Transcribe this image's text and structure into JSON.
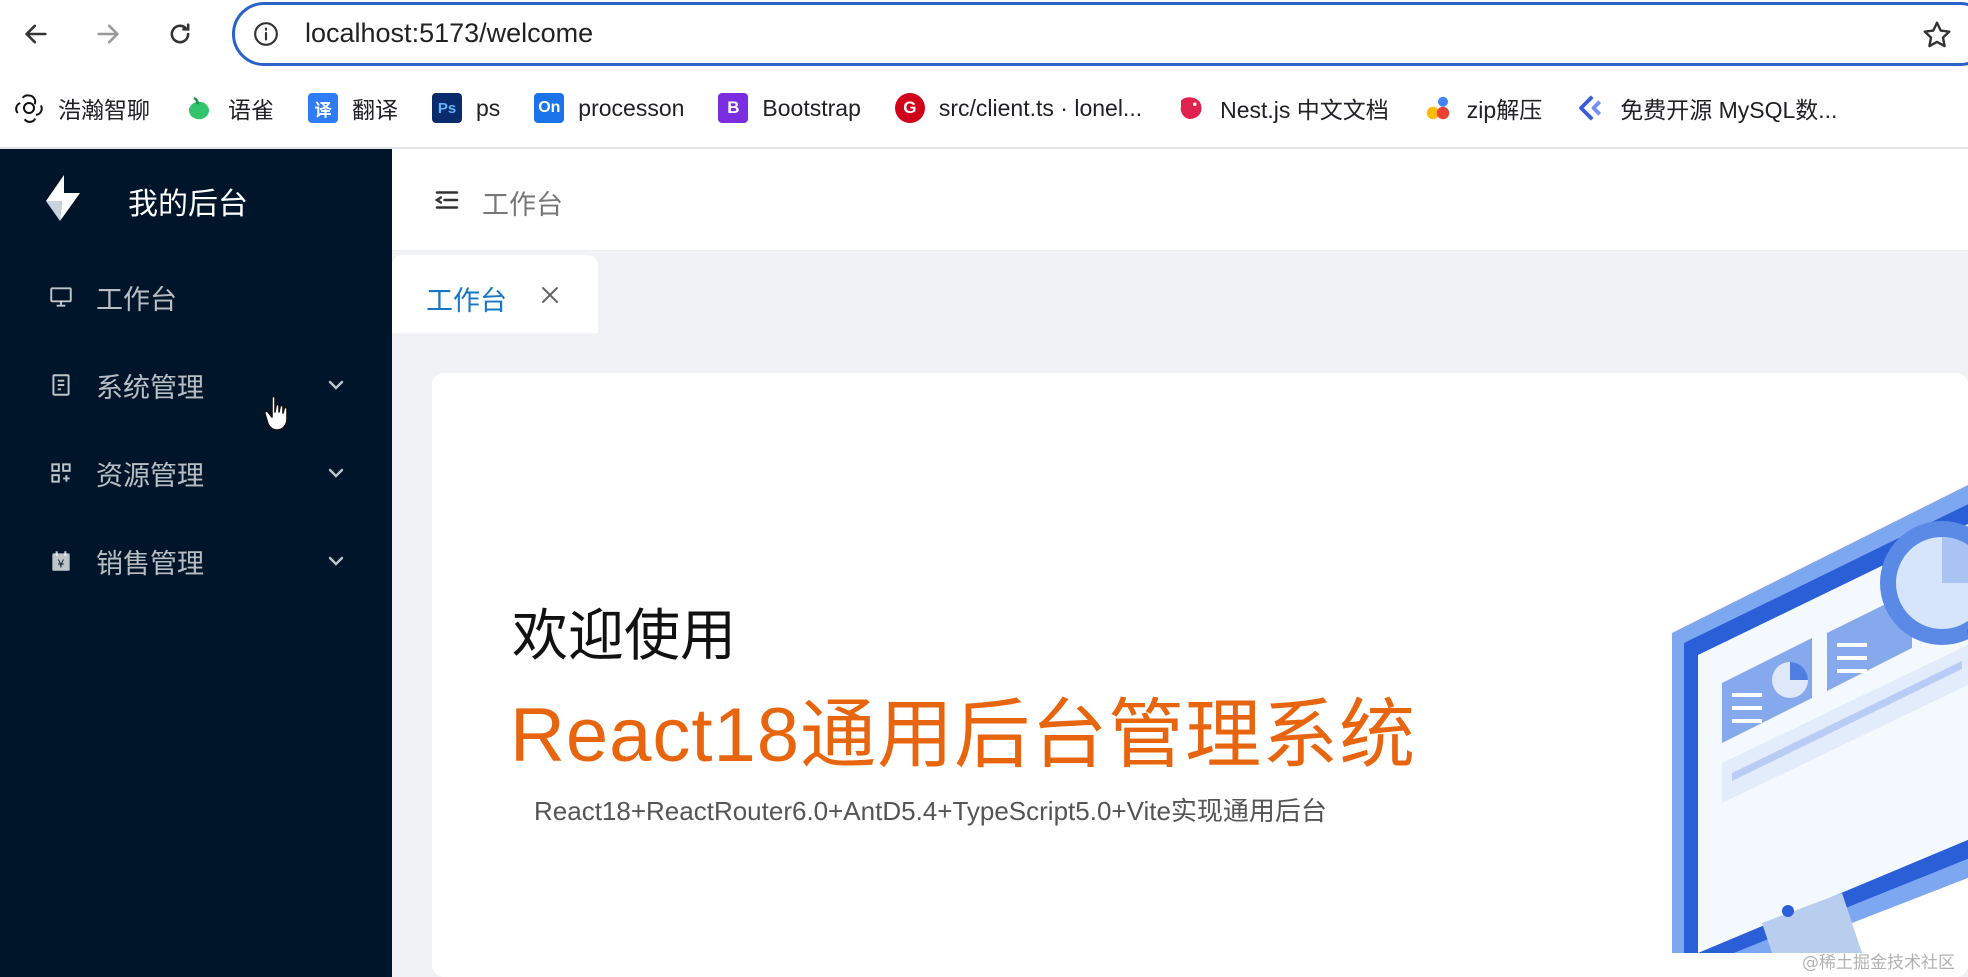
{
  "browser": {
    "url": "localhost:5173/welcome",
    "bookmarks": [
      {
        "label": "浩瀚智聊",
        "icon": "chatgpt-icon",
        "color": "#111111"
      },
      {
        "label": "语雀",
        "icon": "yuque-icon",
        "color": "#31c46d"
      },
      {
        "label": "翻译",
        "icon": "translate-icon",
        "glyph": "译",
        "color": "#2f7cf6"
      },
      {
        "label": "ps",
        "icon": "photoshop-icon",
        "glyph": "Ps",
        "color": "#0a2b6b"
      },
      {
        "label": "processon",
        "icon": "processon-icon",
        "glyph": "On",
        "color": "#1a73e8"
      },
      {
        "label": "Bootstrap",
        "icon": "bootstrap-icon",
        "glyph": "B",
        "color": "#7b2ee0"
      },
      {
        "label": "src/client.ts · lonel...",
        "icon": "gitee-icon",
        "glyph": "G",
        "color": "#d0021b"
      },
      {
        "label": "Nest.js 中文文档",
        "icon": "nestjs-icon",
        "color": "#e0234e"
      },
      {
        "label": "zip解压",
        "icon": "zip-icon",
        "color": "#fbbc04"
      },
      {
        "label": "免费开源 MySQL数...",
        "icon": "mysql-tool-icon",
        "color": "#3b5bdb"
      }
    ]
  },
  "sidebar": {
    "title": "我的后台",
    "items": [
      {
        "label": "工作台",
        "icon": "desktop-icon",
        "has_children": false
      },
      {
        "label": "系统管理",
        "icon": "book-icon",
        "has_children": true
      },
      {
        "label": "资源管理",
        "icon": "appstore-icon",
        "has_children": true
      },
      {
        "label": "销售管理",
        "icon": "money-calendar-icon",
        "has_children": true
      }
    ]
  },
  "header": {
    "breadcrumb": "工作台"
  },
  "tabs": [
    {
      "label": "工作台",
      "active": true
    }
  ],
  "content": {
    "welcome": "欢迎使用",
    "headline": "React18通用后台管理系统",
    "subline": "React18+ReactRouter6.0+AntD5.4+TypeScript5.0+Vite实现通用后台"
  },
  "watermark": "@稀土掘金技术社区",
  "colors": {
    "sidebar_bg": "#001529",
    "accent": "#1677c7",
    "headline": "#e8650f"
  }
}
